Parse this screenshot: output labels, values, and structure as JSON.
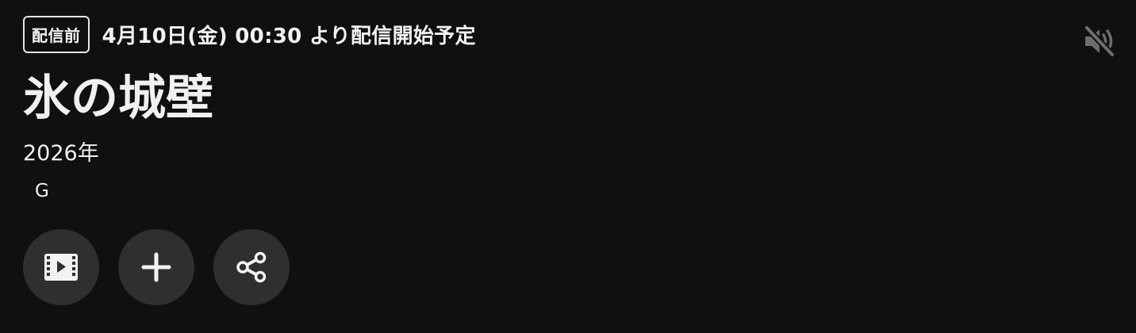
{
  "status": {
    "badge": "配信前",
    "schedule": "4月10日(金) 00:30 より配信開始予定"
  },
  "title": "氷の城壁",
  "year": "2026年",
  "rating": "G",
  "icons": {
    "mute": "volume-muted-icon",
    "trailer": "film-play-icon",
    "add": "plus-icon",
    "share": "share-icon"
  },
  "colors": {
    "background": "#101010",
    "text": "#f2f2f2",
    "button": "#2f2f2f",
    "mute_icon": "#6e6e6e"
  }
}
